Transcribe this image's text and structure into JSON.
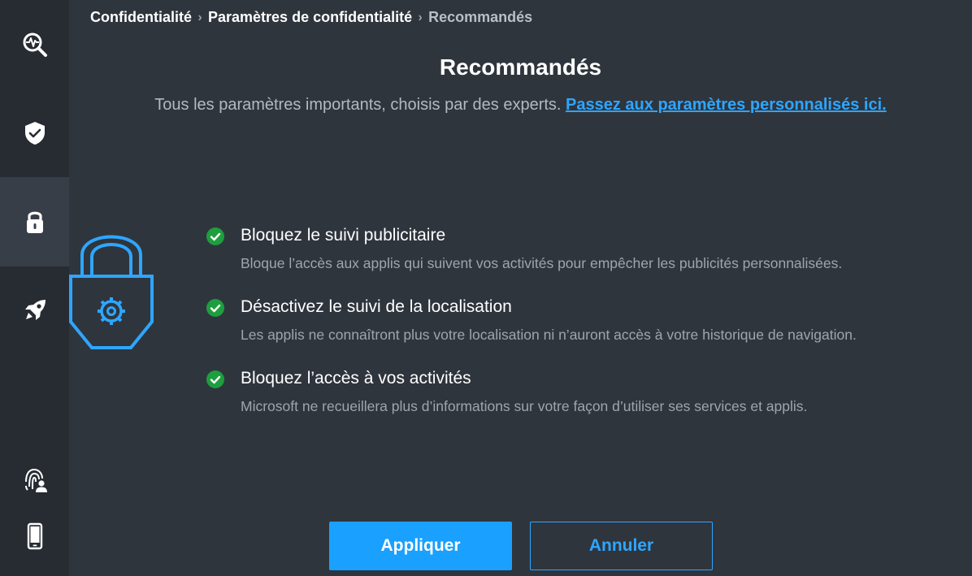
{
  "breadcrumb": {
    "items": [
      "Confidentialité",
      "Paramètres de confidentialité",
      "Recommandés"
    ],
    "separator": "›"
  },
  "header": {
    "title": "Recommandés",
    "subtitle": "Tous les paramètres importants, choisis par des experts.",
    "link": "Passez aux paramètres personnalisés ici."
  },
  "sidebar": {
    "items": [
      {
        "icon": "health-scan-icon",
        "active": false
      },
      {
        "icon": "shield-check-icon",
        "active": false
      },
      {
        "icon": "lock-icon",
        "active": true
      },
      {
        "icon": "rocket-icon",
        "active": false
      },
      {
        "icon": "fingerprint-user-icon",
        "active": false
      },
      {
        "icon": "phone-icon",
        "active": false
      }
    ]
  },
  "features": [
    {
      "title": "Bloquez le suivi publicitaire",
      "desc": "Bloque l’accès aux applis qui suivent vos activités pour empêcher les publicités personnalisées."
    },
    {
      "title": "Désactivez le suivi de la localisation",
      "desc": "Les applis ne connaîtront plus votre localisation ni n’auront accès à votre historique de navigation."
    },
    {
      "title": "Bloquez l’accès à vos activités",
      "desc": "Microsoft ne recueillera plus d’informations sur votre façon d’utiliser ses services et applis."
    }
  ],
  "buttons": {
    "apply": "Appliquer",
    "cancel": "Annuler"
  },
  "colors": {
    "background": "#2f353d",
    "sidebar": "#272c33",
    "sidebar_active": "#383e47",
    "accent": "#1aa0ff",
    "link": "#2ea6ff",
    "check": "#1e9e3e"
  }
}
